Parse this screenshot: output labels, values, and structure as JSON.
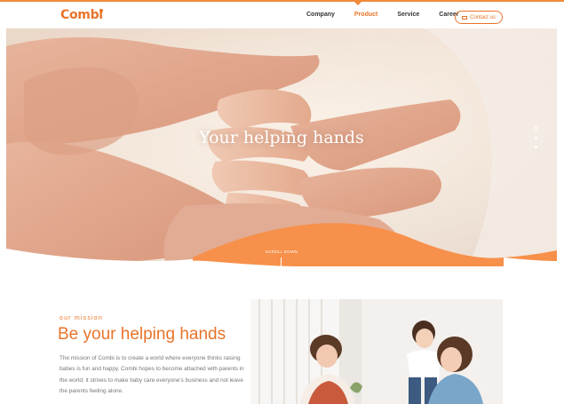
{
  "brand": {
    "logo_text": "Combi",
    "accent": "#e8742a"
  },
  "nav": {
    "items": [
      {
        "label": "Company"
      },
      {
        "label": "Product",
        "active": true
      },
      {
        "label": "Service"
      },
      {
        "label": "Career"
      }
    ],
    "contact_label": "Contact us"
  },
  "hero": {
    "title": "Your helping hands",
    "scroll_label": "SCROLL DOWN",
    "slide_count": 3,
    "active_slide": 1
  },
  "mission": {
    "eyebrow": "our mission",
    "title": "Be your helping hands",
    "text": "The mission of Combi is to create a world where everyone thinks raising babes is fun and happy. Combi hopes to become attached with parents in the world; it strives to make baby care everyone's business and not leave the parents feeling alone."
  }
}
